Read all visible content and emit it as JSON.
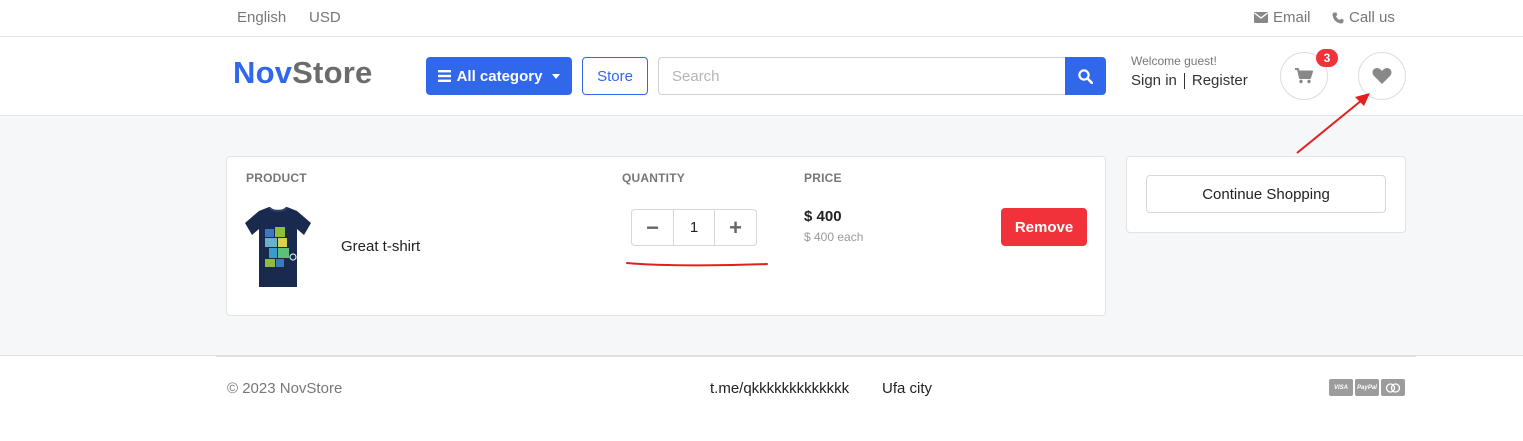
{
  "topbar": {
    "language": "English",
    "currency": "USD",
    "email_label": "Email",
    "call_label": "Call us"
  },
  "header": {
    "logo_part1": "Nov",
    "logo_part2": "Store",
    "all_category_label": "All category",
    "store_label": "Store",
    "search_placeholder": "Search",
    "welcome_text": "Welcome guest!",
    "sign_in_label": "Sign in",
    "register_label": "Register",
    "cart_count": "3"
  },
  "cart": {
    "columns": [
      "PRODUCT",
      "QUANTITY",
      "PRICE"
    ],
    "items": [
      {
        "name": "Great t-shirt",
        "quantity": "1",
        "price": "$ 400",
        "price_each": "$ 400 each",
        "remove_label": "Remove"
      }
    ],
    "minus_symbol": "−",
    "plus_symbol": "+"
  },
  "sidebar": {
    "continue_label": "Continue Shopping"
  },
  "footer": {
    "copyright": "© 2023 NovStore",
    "telegram": "t.me/qkkkkkkkkkkkkk",
    "city": "Ufa city",
    "payment_cards": [
      "VISA",
      "PayPal",
      "MC"
    ]
  },
  "colors": {
    "primary": "#3167eb",
    "danger": "#f2323a",
    "annotation": "#e41f1f"
  }
}
